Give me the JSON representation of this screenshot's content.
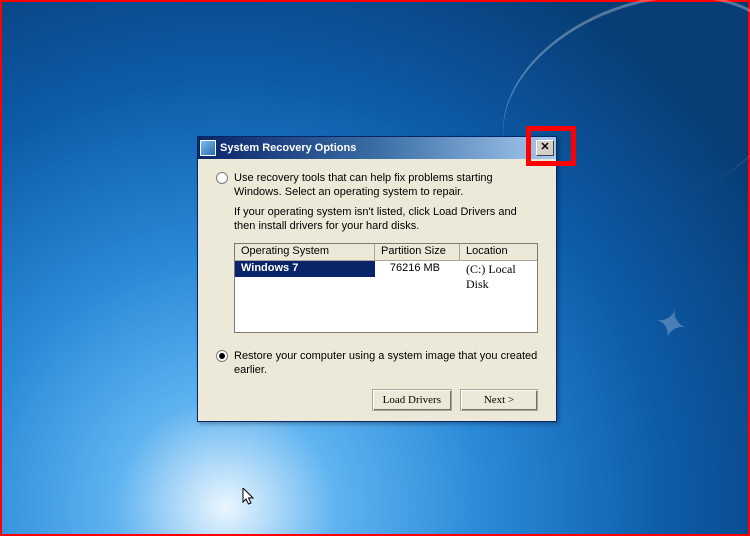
{
  "dialog": {
    "title": "System Recovery Options",
    "option1": {
      "main": "Use recovery tools that can help fix problems starting Windows. Select an operating system to repair.",
      "hint": "If your operating system isn't listed, click Load Drivers and then install drivers for your hard disks."
    },
    "option2": {
      "main": "Restore your computer using a system image that you created earlier."
    },
    "table": {
      "headers": {
        "os": "Operating System",
        "ps": "Partition Size",
        "loc": "Location"
      },
      "row": {
        "os": "Windows 7",
        "ps": "76216 MB",
        "loc": "(C:) Local Disk"
      }
    },
    "buttons": {
      "load_drivers": "Load Drivers",
      "next": "Next >"
    }
  }
}
